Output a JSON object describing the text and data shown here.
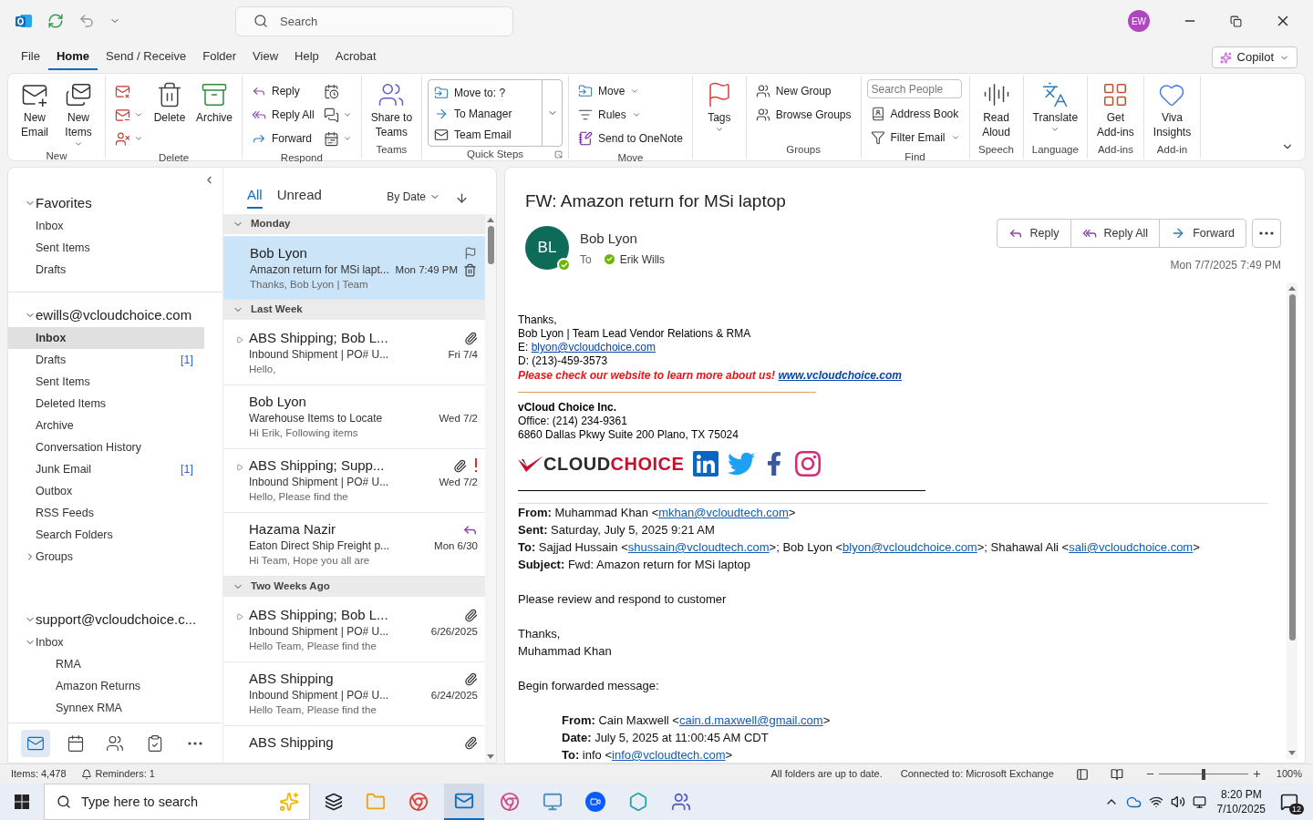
{
  "title_bar": {
    "search_placeholder": "Search",
    "avatar": "EW"
  },
  "menu_tabs": [
    {
      "label": "File",
      "selected": false
    },
    {
      "label": "Home",
      "selected": true
    },
    {
      "label": "Send / Receive",
      "selected": false
    },
    {
      "label": "Folder",
      "selected": false
    },
    {
      "label": "View",
      "selected": false
    },
    {
      "label": "Help",
      "selected": false
    },
    {
      "label": "Acrobat",
      "selected": false
    }
  ],
  "copilot": "Copilot",
  "ribbon": [
    {
      "label": "New",
      "columns": [
        {
          "kind": "large",
          "items": [
            {
              "label": "New\nEmail",
              "dropdown": false
            }
          ]
        },
        {
          "kind": "large",
          "items": [
            {
              "label": "New\nItems",
              "dropdown": true
            }
          ]
        }
      ]
    },
    {
      "label": "Delete",
      "columns": [
        {
          "kind": "icons",
          "items": [
            {
              "dropdown": false
            },
            {
              "dropdown": true
            },
            {
              "dropdown": true
            }
          ]
        },
        {
          "kind": "large",
          "items": [
            {
              "label": "Delete",
              "dropdown": false
            }
          ]
        },
        {
          "kind": "large",
          "items": [
            {
              "label": "Archive",
              "dropdown": false
            }
          ]
        }
      ]
    },
    {
      "label": "Respond",
      "columns": [
        {
          "kind": "stack",
          "items": [
            {
              "label": "Reply",
              "dropdown": false
            },
            {
              "label": "Reply All",
              "dropdown": false
            },
            {
              "label": "Forward",
              "dropdown": false
            }
          ]
        },
        {
          "kind": "icons",
          "items": [
            {
              "dropdown": false
            },
            {
              "dropdown": true
            },
            {
              "dropdown": true
            }
          ]
        }
      ]
    },
    {
      "label": "Teams",
      "columns": [
        {
          "kind": "large",
          "items": [
            {
              "label": "Share to\nTeams",
              "dropdown": false
            }
          ]
        }
      ]
    },
    {
      "label": "Quick Steps",
      "launcher": true,
      "columns": [
        {
          "kind": "box",
          "items": [
            {
              "label": "Move to: ?"
            },
            {
              "label": "To Manager"
            },
            {
              "label": "Team Email"
            }
          ]
        }
      ]
    },
    {
      "label": "Move",
      "columns": [
        {
          "kind": "stack",
          "items": [
            {
              "label": "Move",
              "dropdown": true
            },
            {
              "label": "Rules",
              "dropdown": true
            },
            {
              "label": "Send to OneNote",
              "dropdown": false
            }
          ]
        }
      ]
    },
    {
      "columns": [
        {
          "kind": "large",
          "items": [
            {
              "label": "Tags",
              "dropdown": true
            }
          ]
        }
      ]
    },
    {
      "label": "Groups",
      "columns": [
        {
          "kind": "stack",
          "items": [
            {
              "label": "New Group",
              "dropdown": false
            },
            {
              "label": "Browse Groups",
              "dropdown": false
            }
          ]
        }
      ]
    },
    {
      "label": "Find",
      "columns": [
        {
          "kind": "stack",
          "items": [
            {
              "kind": "field",
              "placeholder": "Search People"
            },
            {
              "label": "Address Book",
              "dropdown": false
            },
            {
              "label": "Filter Email",
              "dropdown": true
            }
          ]
        }
      ]
    },
    {
      "label": "Speech",
      "columns": [
        {
          "kind": "large",
          "items": [
            {
              "label": "Read\nAloud",
              "dropdown": false
            }
          ]
        }
      ]
    },
    {
      "label": "Language",
      "columns": [
        {
          "kind": "large",
          "items": [
            {
              "label": "Translate",
              "dropdown": true
            }
          ]
        }
      ]
    },
    {
      "label": "Add-ins",
      "columns": [
        {
          "kind": "large",
          "items": [
            {
              "label": "Get\nAdd-ins",
              "dropdown": false
            }
          ]
        }
      ]
    },
    {
      "label": "Add-in",
      "columns": [
        {
          "kind": "large",
          "items": [
            {
              "label": "Viva\nInsights",
              "dropdown": false
            }
          ]
        }
      ]
    }
  ],
  "folder_pane": {
    "sections": [
      {
        "label": "Favorites",
        "expanded": true,
        "children": [
          {
            "label": "Inbox",
            "selected": false
          },
          {
            "label": "Sent Items",
            "selected": false
          },
          {
            "label": "Drafts",
            "selected": false
          }
        ]
      },
      {
        "label": "ewills@vcloudchoice.com",
        "expanded": true,
        "children": [
          {
            "label": "Inbox",
            "selected": true
          },
          {
            "label": "Drafts",
            "selected": false,
            "count": "[1]"
          },
          {
            "label": "Sent Items",
            "selected": false
          },
          {
            "label": "Deleted Items",
            "selected": false
          },
          {
            "label": "Archive",
            "selected": false
          },
          {
            "label": "Conversation History",
            "selected": false
          },
          {
            "label": "Junk Email",
            "selected": false,
            "count": "[1]"
          },
          {
            "label": "Outbox",
            "selected": false
          },
          {
            "label": "RSS Feeds",
            "selected": false
          },
          {
            "label": "Search Folders",
            "selected": false
          },
          {
            "label": "Groups",
            "selected": false,
            "expanded": false
          }
        ]
      },
      {
        "label": "support@vcloudchoice.c...",
        "expanded": true,
        "children": [
          {
            "label": "Inbox",
            "selected": false,
            "expanded": true,
            "children": [
              {
                "label": "RMA",
                "selected": false
              },
              {
                "label": "Amazon Returns",
                "selected": false
              },
              {
                "label": "Synnex RMA",
                "selected": false
              }
            ]
          }
        ]
      }
    ]
  },
  "nav_bar": [
    {
      "selected": true
    },
    {
      "selected": false
    },
    {
      "selected": false
    },
    {
      "selected": false
    },
    {
      "selected": false
    }
  ],
  "message_list": {
    "tabs": [
      {
        "label": "All",
        "selected": true
      },
      {
        "label": "Unread",
        "selected": false
      }
    ],
    "sort": "By Date",
    "groups": [
      {
        "label": "Monday",
        "expanded": true,
        "messages": [
          {
            "sender": "Bob Lyon",
            "subject": "Amazon return for MSi lapt...",
            "preview": "Thanks,  Bob Lyon | Team",
            "date": "Mon 7:49 PM",
            "selected": true,
            "conversation": false,
            "attachment": false,
            "important": false,
            "replied": false
          }
        ]
      },
      {
        "label": "Last Week",
        "expanded": true,
        "messages": [
          {
            "sender": "ABS Shipping;  Bob L...",
            "subject": "Inbound Shipment | PO# U...",
            "preview": "Hello,",
            "date": "Fri 7/4",
            "selected": false,
            "conversation": true,
            "attachment": true,
            "important": false,
            "replied": false
          },
          {
            "sender": "Bob Lyon",
            "subject": "Warehouse Items to Locate",
            "preview": "Hi Erik,  Following items",
            "date": "Wed 7/2",
            "selected": false,
            "conversation": false,
            "attachment": false,
            "important": false,
            "replied": false
          },
          {
            "sender": "ABS Shipping;  Supp...",
            "subject": "Inbound Shipment | PO# U...",
            "preview": "Hello,  Please find the",
            "date": "Wed 7/2",
            "selected": false,
            "conversation": true,
            "attachment": true,
            "important": true,
            "replied": false
          },
          {
            "sender": "Hazama Nazir",
            "subject": "Eaton Direct Ship Freight p...",
            "preview": "Hi Team,  Hope you all are",
            "date": "Mon 6/30",
            "selected": false,
            "conversation": false,
            "attachment": false,
            "important": false,
            "replied": true
          }
        ]
      },
      {
        "label": "Two Weeks Ago",
        "expanded": true,
        "messages": [
          {
            "sender": "ABS Shipping;  Bob L...",
            "subject": "Inbound Shipment | PO# U...",
            "preview": "Hello Team,  Please find the",
            "date": "6/26/2025",
            "selected": false,
            "conversation": true,
            "attachment": true,
            "important": false,
            "replied": false
          },
          {
            "sender": "ABS Shipping",
            "subject": "Inbound Shipment | PO# U...",
            "preview": "Hello Team,  Please find the",
            "date": "6/24/2025",
            "selected": false,
            "conversation": false,
            "attachment": true,
            "important": false,
            "replied": false
          },
          {
            "sender": "ABS Shipping",
            "selected": false,
            "conversation": false,
            "attachment": true,
            "important": false,
            "replied": false
          }
        ]
      }
    ]
  },
  "reading_pane": {
    "subject": "FW: Amazon return for MSi laptop",
    "avatar": "BL",
    "sender": "Bob Lyon",
    "to_label": "To",
    "recipient": "Erik Wills",
    "actions": [
      "Reply",
      "Reply All",
      "Forward"
    ],
    "date": "Mon 7/7/2025 7:49 PM",
    "body": [
      {
        "kind": "sig",
        "segments": [
          {
            "kind": "text",
            "text": "Thanks,"
          }
        ]
      },
      {
        "kind": "sig",
        "segments": [
          {
            "kind": "text",
            "text": "Bob Lyon | Team Lead Vendor Relations & RMA"
          }
        ]
      },
      {
        "kind": "sig",
        "segments": [
          {
            "kind": "text",
            "text": "E: "
          },
          {
            "kind": "link",
            "text": "blyon@vcloudchoice.com"
          }
        ]
      },
      {
        "kind": "sig",
        "segments": [
          {
            "kind": "text",
            "text": "D: (213)-459-3573"
          }
        ]
      },
      {
        "kind": "promo",
        "segments": [
          {
            "kind": "text",
            "text": "Please check our website to learn more about us! "
          },
          {
            "kind": "link",
            "text": "www.vcloudchoice.com"
          }
        ]
      },
      {
        "kind": "orange_rule"
      },
      {
        "kind": "company",
        "segments": [
          {
            "kind": "text",
            "text": "vCloud Choice Inc."
          }
        ]
      },
      {
        "kind": "sig",
        "segments": [
          {
            "kind": "text",
            "text": "Office: (214) 234-9361"
          }
        ]
      },
      {
        "kind": "sig",
        "segments": [
          {
            "kind": "text",
            "text": "6860 Dallas Pkwy Suite 200 Plano, TX 75024"
          }
        ]
      },
      {
        "kind": "logo",
        "words": [
          "CLOUD",
          "CHOICE"
        ]
      },
      {
        "kind": "black_rule"
      },
      {
        "kind": "divider"
      },
      {
        "kind": "mail",
        "segments": [
          {
            "kind": "text",
            "text": "**From:** Muhammad Khan <"
          },
          {
            "kind": "link",
            "text": "mkhan@vcloudtech.com"
          },
          {
            "kind": "text",
            "text": ">"
          }
        ]
      },
      {
        "kind": "mail",
        "segments": [
          {
            "kind": "text",
            "text": "**Sent:** Saturday, July 5, 2025 9:21 AM"
          }
        ]
      },
      {
        "kind": "mail",
        "segments": [
          {
            "kind": "text",
            "text": "**To:** Sajjad Hussain <"
          },
          {
            "kind": "link",
            "text": "shussain@vcloudtech.com"
          },
          {
            "kind": "text",
            "text": ">; Bob Lyon <"
          },
          {
            "kind": "link",
            "text": "blyon@vcloudchoice.com"
          },
          {
            "kind": "text",
            "text": ">; Shahawal Ali <"
          },
          {
            "kind": "link",
            "text": "sali@vcloudchoice.com"
          },
          {
            "kind": "text",
            "text": ">"
          }
        ]
      },
      {
        "kind": "mail",
        "segments": [
          {
            "kind": "text",
            "text": "**Subject:** Fwd: Amazon return for MSi laptop"
          }
        ]
      },
      {
        "kind": "blank"
      },
      {
        "kind": "mail",
        "segments": [
          {
            "kind": "text",
            "text": "Please review and respond to customer"
          }
        ]
      },
      {
        "kind": "blank"
      },
      {
        "kind": "mail",
        "segments": [
          {
            "kind": "text",
            "text": "Thanks,"
          }
        ]
      },
      {
        "kind": "mail",
        "segments": [
          {
            "kind": "text",
            "text": "Muhammad Khan"
          }
        ]
      },
      {
        "kind": "blank"
      },
      {
        "kind": "mail",
        "segments": [
          {
            "kind": "text",
            "text": "Begin forwarded message:"
          }
        ]
      },
      {
        "kind": "blank"
      },
      {
        "kind": "quoted",
        "segments": [
          {
            "kind": "text",
            "text": "**From:** Cain Maxwell <"
          },
          {
            "kind": "link",
            "text": "cain.d.maxwell@gmail.com"
          },
          {
            "kind": "text",
            "text": ">"
          }
        ]
      },
      {
        "kind": "quoted",
        "segments": [
          {
            "kind": "text",
            "text": "**Date:** July 5, 2025 at 11:00:45 AM CDT"
          }
        ]
      },
      {
        "kind": "quoted",
        "segments": [
          {
            "kind": "text",
            "text": "**To:** info <"
          },
          {
            "kind": "link",
            "text": "info@vcloudtech.com"
          },
          {
            "kind": "text",
            "text": ">"
          }
        ]
      }
    ]
  },
  "status_bar": {
    "items": "Items: 4,478",
    "reminders": "Reminders: 1",
    "sync": "All folders are up to date.",
    "connection": "Connected to: Microsoft Exchange",
    "zoom": {
      "level": 0.5,
      "reading": "100%"
    }
  },
  "taskbar": {
    "search_placeholder": "Type here to search",
    "time": "8:20 PM",
    "date": "7/10/2025",
    "notifications": "12"
  }
}
